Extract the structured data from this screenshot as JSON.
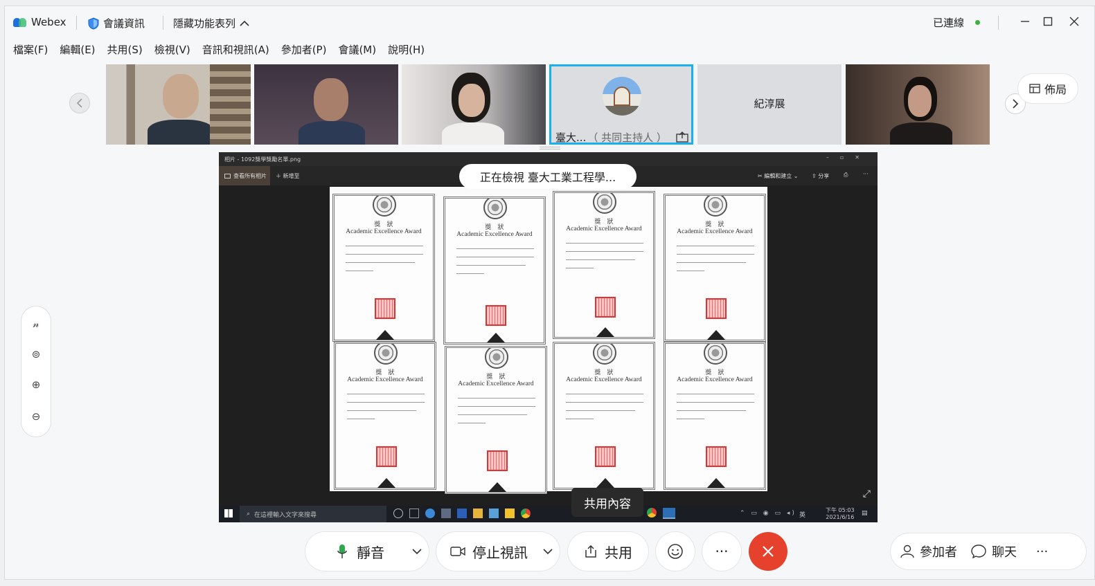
{
  "titlebar": {
    "app_name": "Webex",
    "meeting_info": "會議資訊",
    "hide_menu": "隱藏功能表列",
    "status": "已連線"
  },
  "menu": [
    "檔案(F)",
    "編輯(E)",
    "共用(S)",
    "檢視(V)",
    "音訊和視訊(A)",
    "參加者(P)",
    "會議(M)",
    "說明(H)"
  ],
  "participants": {
    "host_label": "臺大...",
    "host_role": "（ 共同主持人 ）",
    "name_tile": "紀淳展"
  },
  "layout_button": "佈局",
  "viewing_banner": "正在檢視 臺大工業工程學...",
  "shared_window": {
    "title": "相片 - 1092獎學獎勵名單.png",
    "view_all": "查看所有相片",
    "add_to": "新增至",
    "edit": "編輯和建立",
    "share": "分享",
    "search_placeholder": "在這裡輸入文字來搜尋",
    "clock_time": "下午 05:03",
    "clock_date": "2021/6/16",
    "ime": "英"
  },
  "certificate": {
    "heading": "獎　狀",
    "award": "Academic Excellence Award"
  },
  "share_content_tooltip": "共用內容",
  "controls": {
    "mute": "靜音",
    "stop_video": "停止視訊",
    "share": "共用",
    "participants": "參加者",
    "chat": "聊天"
  },
  "colors": {
    "end_call": "#e5412d",
    "active_speaker": "#1ab0f0",
    "connected": "#3cb043",
    "webex_blue": "#1e6fe0"
  }
}
